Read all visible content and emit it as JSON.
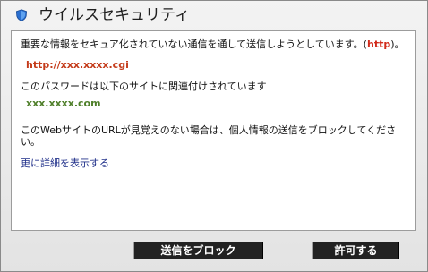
{
  "window": {
    "title": "ウイルスセキュリティ"
  },
  "message": {
    "warning_prefix": "重要な情報をセキュア化されていない通信を通して送信しようとしています。(",
    "protocol": "http",
    "warning_suffix": ")。",
    "target_url": "http://xxx.xxxx.cgi",
    "password_note": "このパスワードは以下のサイトに関連付けされています",
    "password_site": "xxx.xxxx.com",
    "unknown_site_line1": "このWebサイトのURLが見覚えのない場合は、個人情報の送信をブロックしてくださ",
    "unknown_site_line2": "い。"
  },
  "details_link": "更に詳細を表示する",
  "buttons": {
    "block": "送信をブロック",
    "allow": "許可する"
  },
  "colors": {
    "warning_url": "#c43b1a",
    "site": "#4f7f2a",
    "link": "#20308a",
    "button_bg": "#222222"
  }
}
